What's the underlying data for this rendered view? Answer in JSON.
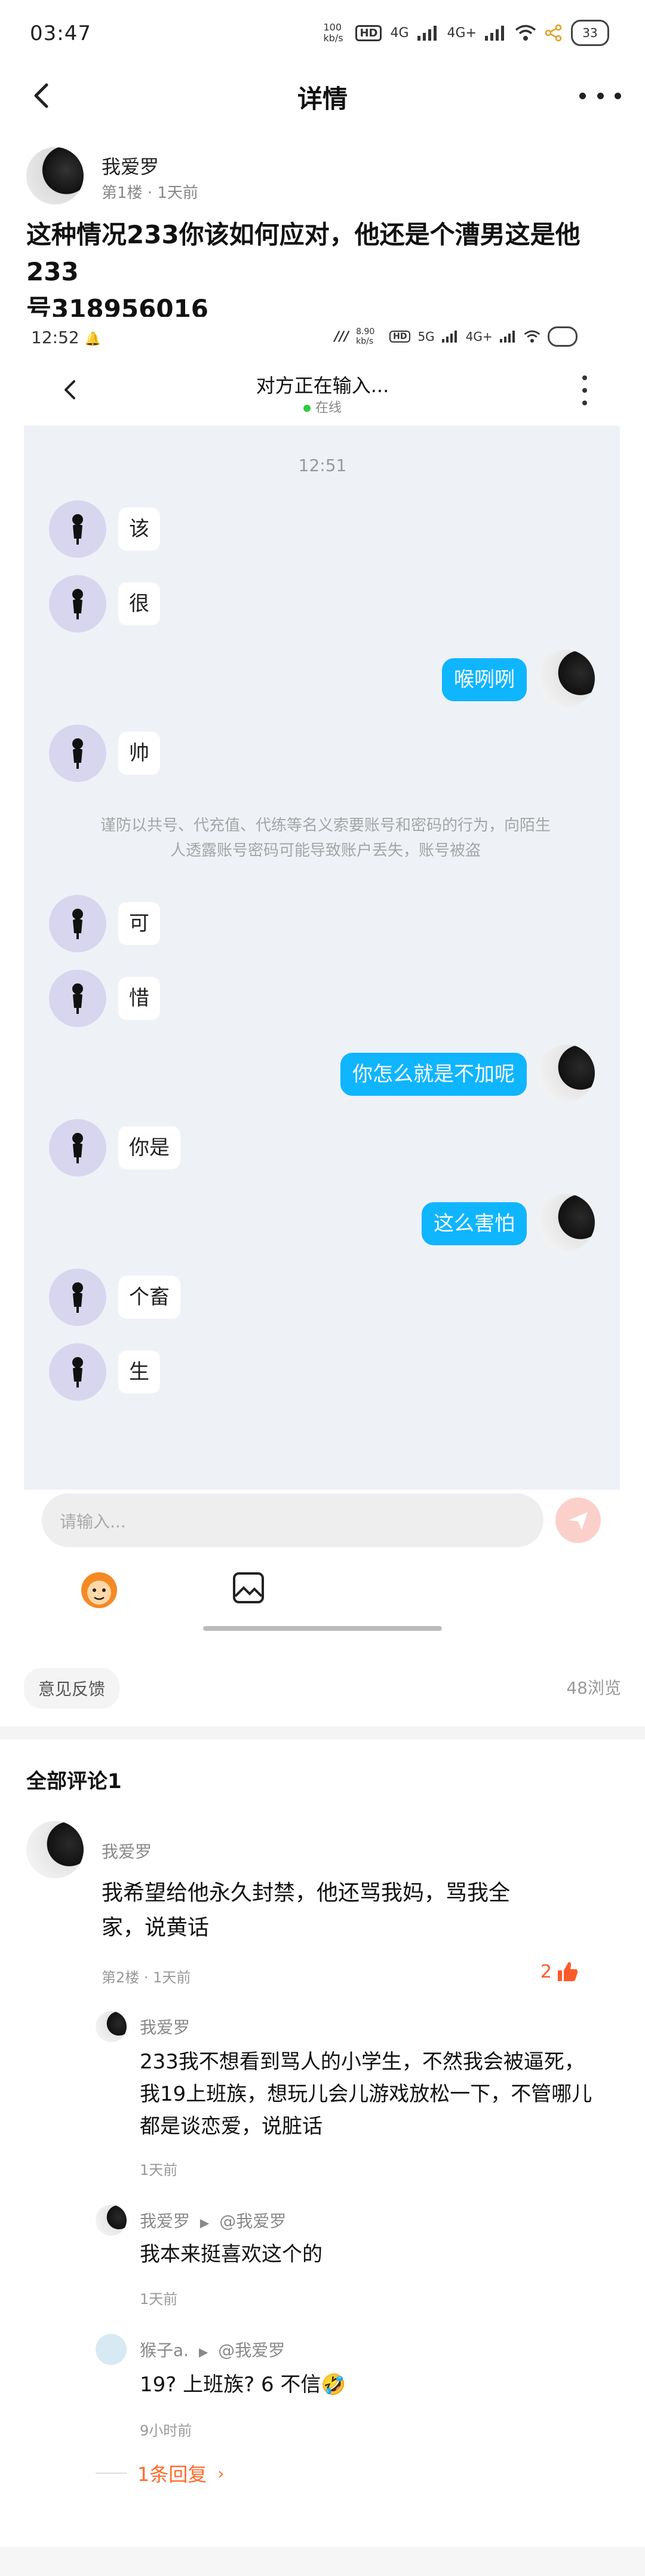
{
  "status_bar": {
    "time": "03:47",
    "net_speed": "100 kb/s",
    "signal_1": "4G",
    "signal_2": "4G+",
    "battery": "33"
  },
  "header": {
    "title": "详情"
  },
  "post": {
    "author": "我爱罗",
    "meta": "第1楼 · 1天前",
    "text_line1": "这种情况233你该如何应对，他还是个漕男这是他233",
    "text_line2": "号318956016"
  },
  "shot": {
    "status_time": "12:52",
    "status_speed": "8.90 kb/s",
    "status_5g": "5G",
    "status_4g": "4G+",
    "chat_title": "对方正在输入...",
    "online": "在线",
    "time_sep": "12:51",
    "messages": [
      {
        "side": "left",
        "text": "该"
      },
      {
        "side": "left",
        "text": "很"
      },
      {
        "side": "right",
        "text": "喉咧咧"
      },
      {
        "side": "left",
        "text": "帅"
      },
      {
        "side": "left",
        "text": "可"
      },
      {
        "side": "left",
        "text": "惜"
      },
      {
        "side": "right",
        "text": "你怎么就是不加呢"
      },
      {
        "side": "left",
        "text": "你是"
      },
      {
        "side": "right",
        "text": "这么害怕"
      },
      {
        "side": "left",
        "text": "个畜"
      },
      {
        "side": "left",
        "text": "生"
      }
    ],
    "system_note_line1": "谨防以共号、代充值、代练等名义索要账号和密码的行为，向陌生",
    "system_note_line2": "人透露账号密码可能导致账户丢失，账号被盗",
    "input_placeholder": "请输入..."
  },
  "feedback_label": "意见反馈",
  "views": "48浏览",
  "comments": {
    "title": "全部评论1",
    "main": {
      "author": "我爱罗",
      "text_line1": "我希望给他永久封禁，他还骂我妈，骂我全",
      "text_line2": "家，说黄话",
      "meta": "第2楼 · 1天前",
      "likes": "2"
    },
    "replies": [
      {
        "author": "我爱罗",
        "lines": [
          "233我不想看到骂人的小学生，不然我会被逼死，",
          "我19上班族，想玩儿会儿游戏放松一下，不管哪儿",
          "都是谈恋爱，说脏话"
        ],
        "time": "1天前"
      },
      {
        "author": "我爱罗",
        "reply_to": "@我爱罗",
        "lines": [
          "我本来挺喜欢这个的"
        ],
        "time": "1天前"
      },
      {
        "author": "猴子a.",
        "reply_to": "@我爱罗",
        "lines": [
          "19? 上班族? 6 不信🤣"
        ],
        "time": "9小时前"
      }
    ],
    "more_replies": "1条回复"
  }
}
